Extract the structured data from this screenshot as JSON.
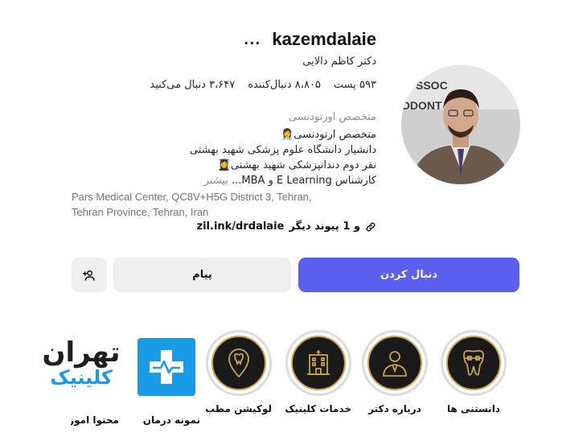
{
  "profile": {
    "username": "kazemdalaie",
    "more_glyph": "...",
    "full_name": "دکتر کاظم دالایی",
    "stats": {
      "posts": "۵۹۳ پست",
      "followers": "۸،۸۰۵ دنبال‌کننده",
      "following": "۳،۶۴۷ دنبال می‌کنید"
    },
    "category": "متخصص اورتودنسی",
    "bio": {
      "line1": "متخصص ارتودنسی👩‍⚕️",
      "line2": "دانشیار دانشگاه علوم پزشکی شهید بهشتی",
      "line3": "نفر دوم دندانپزشکی شهید بهشتی👩‍🎓",
      "line4": "کارشناس E Learning و MBA...",
      "more": "بیشتر"
    },
    "address_line1": "Pars Medical Center, QC8V+H5G District 3, Tehran,",
    "address_line2": "Tehran Province, Tehran, Iran",
    "link": {
      "url": "zil.ink/drdalaie",
      "extra": "و 1 پیوند دیگر"
    }
  },
  "buttons": {
    "follow": "دنبال کردن",
    "message": "پیام",
    "suggest_icon": "add-person-icon"
  },
  "highlights": [
    {
      "label": "دانستنی ها",
      "icon": "tooth-braces-icon"
    },
    {
      "label": "درباره دکتر",
      "icon": "doctor-icon"
    },
    {
      "label": "خدمات کلینیک",
      "icon": "clinic-building-icon"
    },
    {
      "label": "لوکیشن مطب",
      "icon": "location-pin-tooth-icon"
    },
    {
      "label": "نمونه درمان",
      "icon": "medical-cross-icon"
    },
    {
      "label": "محتوا اموزشی",
      "icon": "tehran-clinic-logo"
    }
  ],
  "logo": {
    "line1": "تهران",
    "line2": "کلینیک"
  },
  "colors": {
    "follow_button": "#5b5ff0",
    "secondary_button": "#efefef",
    "highlight_gold": "#c7a24a",
    "brand_blue": "#1a9be8"
  }
}
